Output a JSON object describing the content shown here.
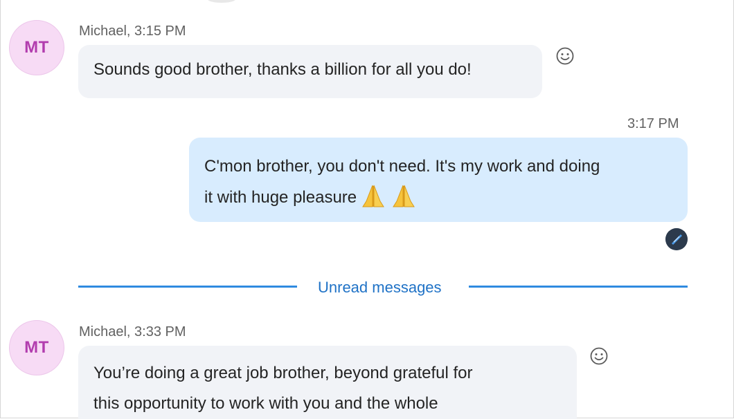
{
  "messages": [
    {
      "avatar_initials": "MT",
      "meta": "Michael, 3:15 PM",
      "text": "Sounds good brother, thanks a billion for all you do!"
    },
    {
      "time": "3:17 PM",
      "lines": [
        "C'mon brother, you don't need. It's my work and doing",
        "it with huge pleasure"
      ],
      "emojis": [
        "folded-hands-icon",
        "folded-hands-icon"
      ]
    },
    {
      "avatar_initials": "MT",
      "meta": "Michael, 3:33 PM",
      "lines": [
        "You’re doing a great job brother, beyond grateful for",
        "this opportunity to work with you and the whole"
      ]
    }
  ],
  "divider": {
    "label": "Unread messages"
  },
  "colors": {
    "avatar_bg": "#f7dbf5",
    "avatar_text": "#b23dae",
    "incoming_bubble": "#f1f3f7",
    "outgoing_bubble": "#d8ecfe",
    "divider": "#2f8ae0"
  }
}
